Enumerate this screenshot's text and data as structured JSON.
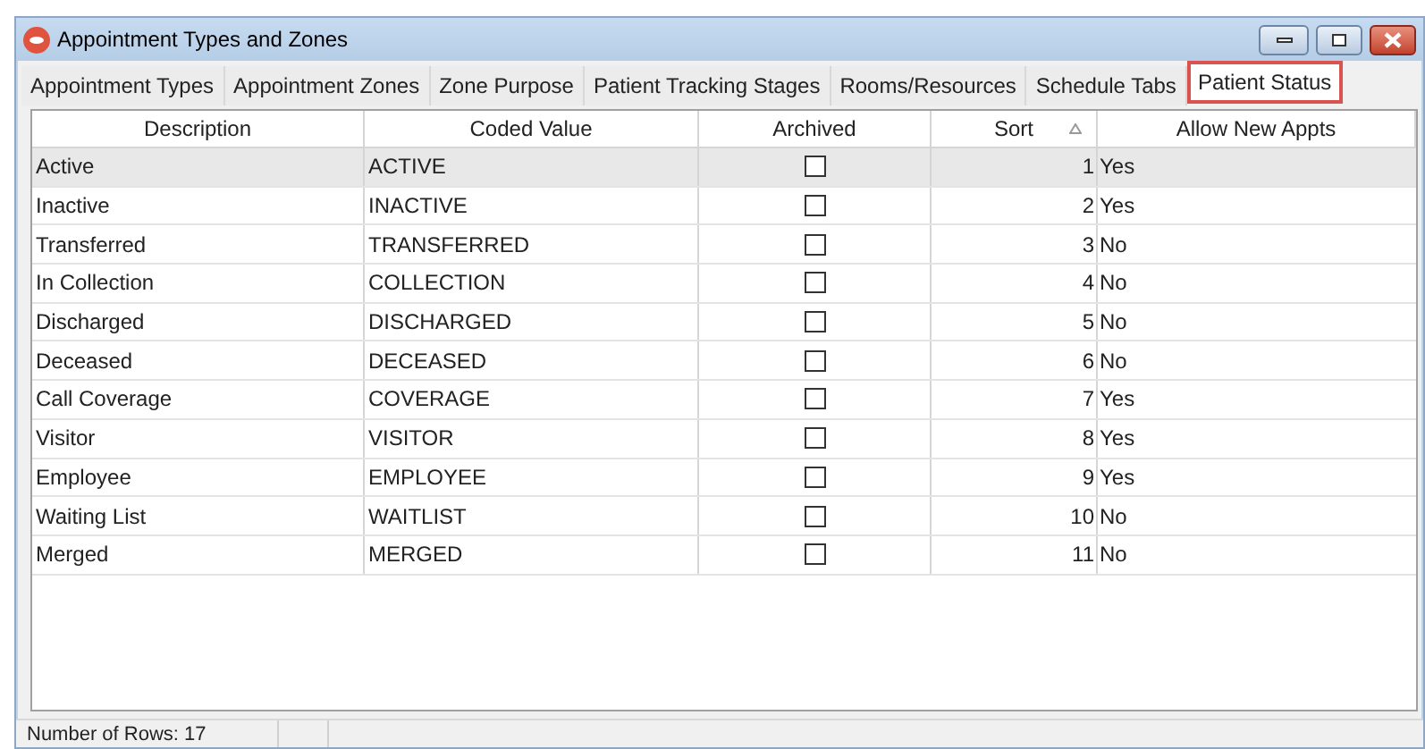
{
  "window": {
    "title": "Appointment Types and Zones"
  },
  "tabs": [
    {
      "label": "Appointment Types",
      "selected": false
    },
    {
      "label": "Appointment Zones",
      "selected": false
    },
    {
      "label": "Zone Purpose",
      "selected": false
    },
    {
      "label": "Patient Tracking Stages",
      "selected": false
    },
    {
      "label": "Rooms/Resources",
      "selected": false
    },
    {
      "label": "Schedule Tabs",
      "selected": false
    },
    {
      "label": "Patient Status",
      "selected": true
    }
  ],
  "table": {
    "columns": [
      "Description",
      "Coded Value",
      "Archived",
      "Sort",
      "Allow New Appts"
    ],
    "rows": [
      {
        "description": "Active",
        "coded_value": "ACTIVE",
        "archived": false,
        "sort": "1",
        "allow_new_appts": "Yes",
        "selected": true
      },
      {
        "description": "Inactive",
        "coded_value": "INACTIVE",
        "archived": false,
        "sort": "2",
        "allow_new_appts": "Yes",
        "selected": false
      },
      {
        "description": "Transferred",
        "coded_value": "TRANSFERRED",
        "archived": false,
        "sort": "3",
        "allow_new_appts": "No",
        "selected": false
      },
      {
        "description": "In Collection",
        "coded_value": "COLLECTION",
        "archived": false,
        "sort": "4",
        "allow_new_appts": "No",
        "selected": false
      },
      {
        "description": "Discharged",
        "coded_value": "DISCHARGED",
        "archived": false,
        "sort": "5",
        "allow_new_appts": "No",
        "selected": false
      },
      {
        "description": "Deceased",
        "coded_value": "DECEASED",
        "archived": false,
        "sort": "6",
        "allow_new_appts": "No",
        "selected": false
      },
      {
        "description": "Call Coverage",
        "coded_value": "COVERAGE",
        "archived": false,
        "sort": "7",
        "allow_new_appts": "Yes",
        "selected": false
      },
      {
        "description": "Visitor",
        "coded_value": "VISITOR",
        "archived": false,
        "sort": "8",
        "allow_new_appts": "Yes",
        "selected": false
      },
      {
        "description": "Employee",
        "coded_value": "EMPLOYEE",
        "archived": false,
        "sort": "9",
        "allow_new_appts": "Yes",
        "selected": false
      },
      {
        "description": "Waiting List",
        "coded_value": "WAITLIST",
        "archived": false,
        "sort": "10",
        "allow_new_appts": "No",
        "selected": false
      },
      {
        "description": "Merged",
        "coded_value": "MERGED",
        "archived": false,
        "sort": "11",
        "allow_new_appts": "No",
        "selected": false
      }
    ]
  },
  "status_bar": {
    "text": "Number of Rows: 17"
  }
}
